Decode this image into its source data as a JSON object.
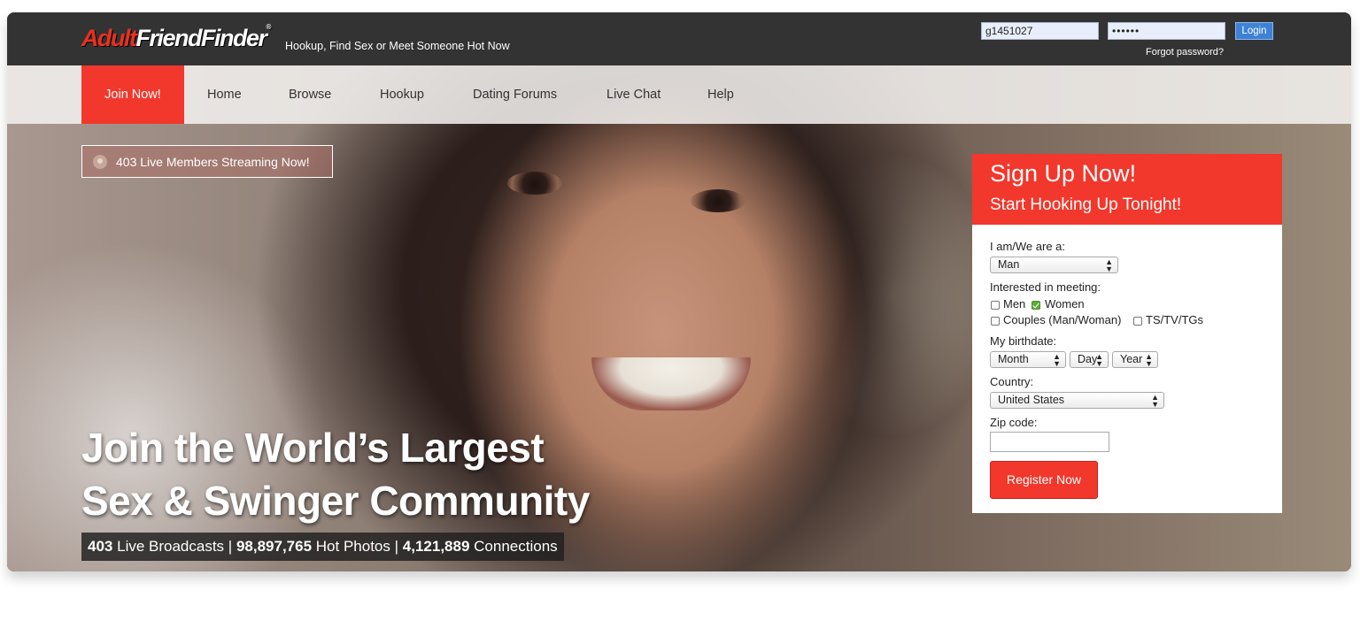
{
  "header": {
    "logo_part1": "Adult",
    "logo_part2": "FriendFinder",
    "logo_mark": "®",
    "tagline": "Hookup, Find Sex or Meet Someone Hot Now",
    "login": {
      "username_value": "g1451027",
      "password_value": "••••••",
      "login_label": "Login",
      "forgot_label": "Forgot password?"
    }
  },
  "nav": {
    "join_label": "Join Now!",
    "items": [
      {
        "label": "Home"
      },
      {
        "label": "Browse"
      },
      {
        "label": "Hookup"
      },
      {
        "label": "Dating Forums"
      },
      {
        "label": "Live Chat"
      },
      {
        "label": "Help"
      }
    ]
  },
  "hero": {
    "live_members": "403 Live Members Streaming Now!",
    "headline_line1": "Join the World’s Largest",
    "headline_line2": "Sex & Swinger Community",
    "stats": {
      "broadcasts_count": "403",
      "broadcasts_label": "Live Broadcasts",
      "photos_count": "98,897,765",
      "photos_label": "Hot Photos",
      "connections_count": "4,121,889",
      "connections_label": "Connections",
      "separator": "|"
    }
  },
  "signup": {
    "title": "Sign Up Now!",
    "subtitle": "Start Hooking Up Tonight!",
    "iam_label": "I am/We are a:",
    "iam_value": "Man",
    "interested_label": "Interested in meeting:",
    "options": [
      {
        "label": "Men",
        "checked": false
      },
      {
        "label": "Women",
        "checked": true
      },
      {
        "label": "Couples (Man/Woman)",
        "checked": false
      },
      {
        "label": "TS/TV/TGs",
        "checked": false
      }
    ],
    "birthdate_label": "My birthdate:",
    "month_value": "Month",
    "day_value": "Day",
    "year_value": "Year",
    "country_label": "Country:",
    "country_value": "United States",
    "zip_label": "Zip code:",
    "zip_value": "",
    "register_label": "Register Now"
  },
  "colors": {
    "brand_red": "#f2372c",
    "topbar": "#333333",
    "login_button": "#3c82d6",
    "checkbox_checked": "#5cae3a"
  }
}
